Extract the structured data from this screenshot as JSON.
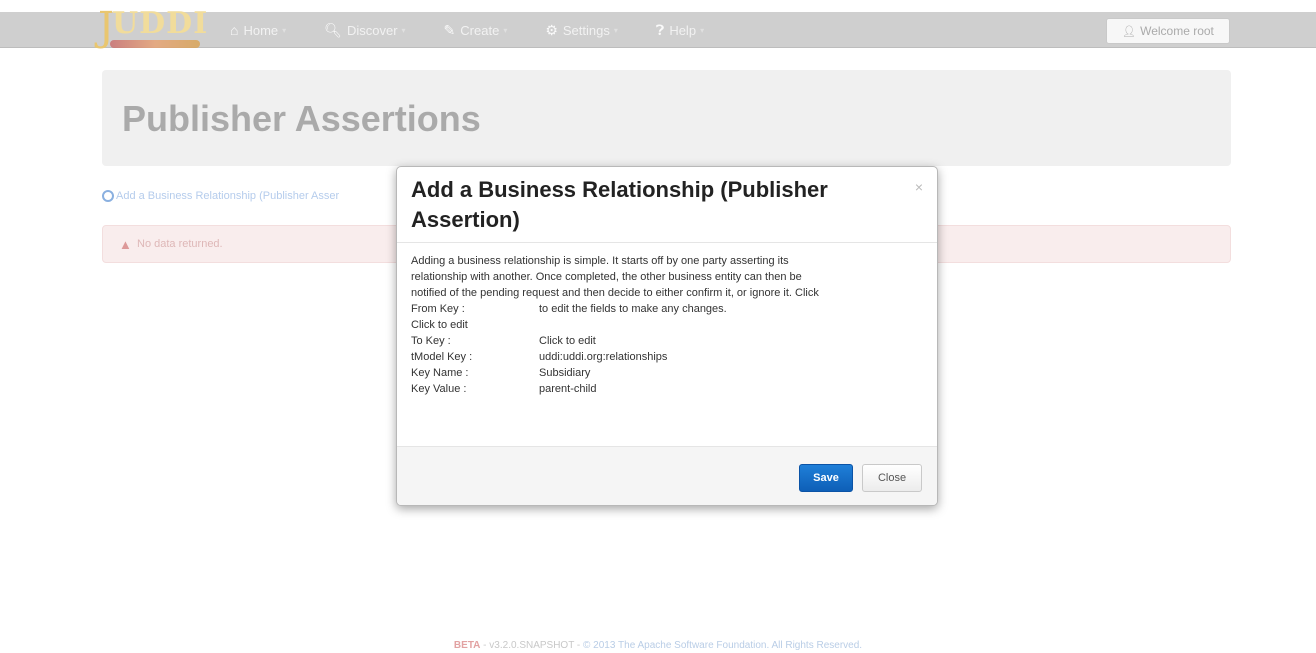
{
  "navbar": {
    "logo_text": "UDDI",
    "logo_letter": "J",
    "items": [
      {
        "label": "Home",
        "icon": "home-icon"
      },
      {
        "label": "Discover",
        "icon": "search-icon"
      },
      {
        "label": "Create",
        "icon": "pencil-icon"
      },
      {
        "label": "Settings",
        "icon": "gear-icon"
      },
      {
        "label": "Help",
        "icon": "question-icon"
      }
    ],
    "welcome": "Welcome root"
  },
  "page": {
    "title": "Publisher Assertions",
    "add_link": "Add a Business Relationship (Publisher Asser",
    "alert_text": "No data returned."
  },
  "modal": {
    "title": "Add a Business Relationship (Publisher Assertion)",
    "close_symbol": "×",
    "intro_line1": "Adding a business relationship is simple. It starts off by one party asserting its",
    "intro_line2": "relationship with another. Once completed, the other business entity can then be",
    "intro_line3": "notified of the pending request and then decide to either confirm it, or ignore it. Click",
    "from_key_label": "From Key :",
    "from_key_value": "to edit the fields to make any changes.",
    "click_to_edit": "Click to edit",
    "to_key_label": "To Key :",
    "to_key_value": "Click to edit",
    "tmodel_label": "tModel Key :",
    "tmodel_value": "uddi:uddi.org:relationships",
    "keyname_label": "Key Name :",
    "keyname_value": "Subsidiary",
    "keyvalue_label": "Key Value :",
    "keyvalue_value": "parent-child",
    "save_label": "Save",
    "close_label": "Close"
  },
  "footer": {
    "beta": "BETA",
    "version": " - v3.2.0.SNAPSHOT - ",
    "copyright": "© 2013 The Apache Software Foundation. All Rights Reserved."
  },
  "colors": {
    "primary_button": "#0e5fb7",
    "navbar": "#cfcfcf",
    "alert_bg": "#f9eded"
  }
}
